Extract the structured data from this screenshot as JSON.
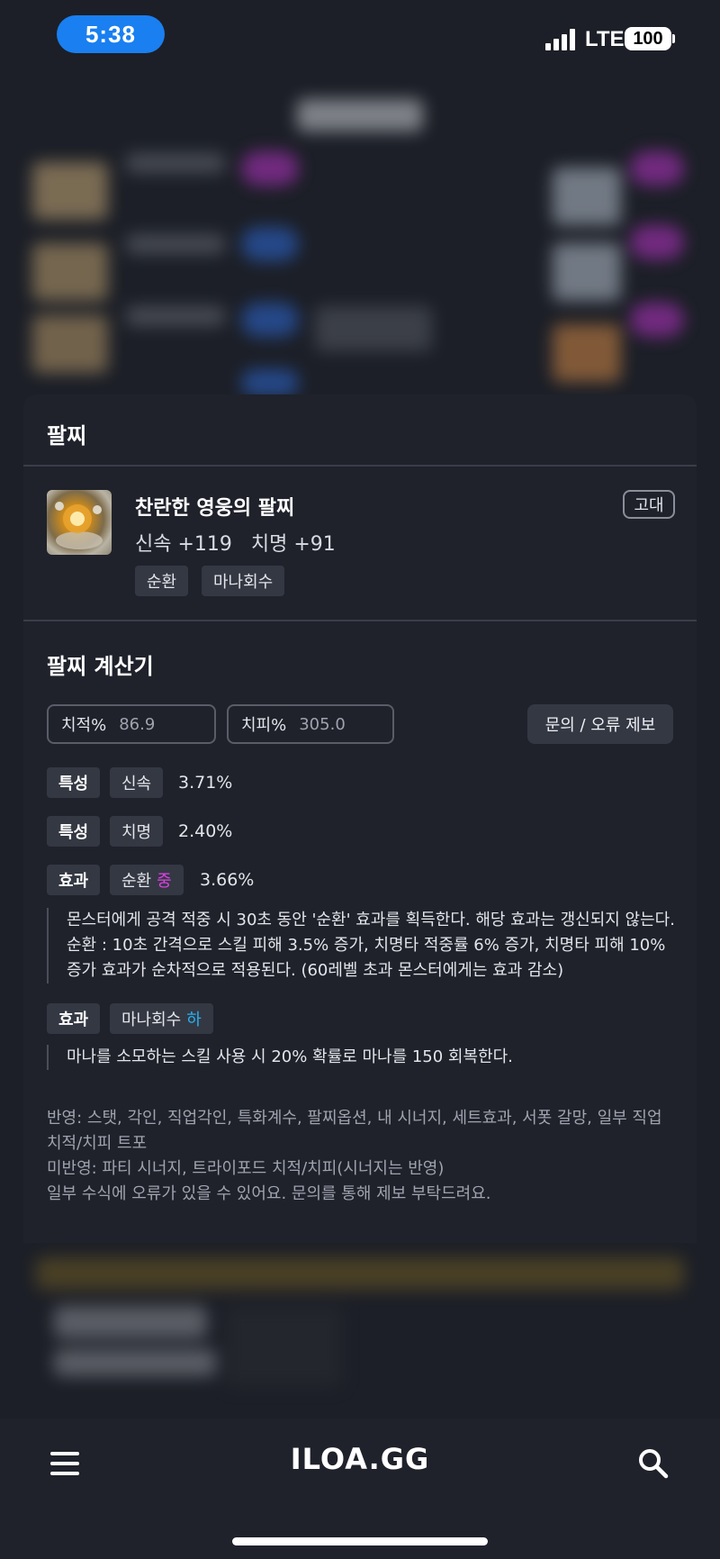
{
  "status": {
    "time": "5:38",
    "network": "LTE",
    "battery": "100"
  },
  "modal": {
    "title": "팔찌",
    "item": {
      "name": "찬란한 영웅의 팔찌",
      "stats": "신속 +119   치명 +91",
      "grade": "고대",
      "tags": [
        "순환",
        "마나회수"
      ]
    },
    "calculator": {
      "title": "팔찌 계산기",
      "crit_rate": {
        "label": "치적%",
        "placeholder": "86.9"
      },
      "crit_damage": {
        "label": "치피%",
        "placeholder": "305.0"
      },
      "report_button": "문의 / 오류 제보",
      "rows": [
        {
          "type": "특성",
          "name": "신속",
          "value": "3.71%"
        },
        {
          "type": "특성",
          "name": "치명",
          "value": "2.40%"
        },
        {
          "type": "효과",
          "name": "순환",
          "level": "중",
          "value": "3.66%"
        },
        {
          "type": "효과",
          "name": "마나회수",
          "level": "하"
        }
      ],
      "desc_cycle": "몬스터에게 공격 적중 시 30초 동안 '순환' 효과를 획득한다. 해당 효과는 갱신되지 않는다. 순환 : 10초 간격으로 스킬 피해 3.5% 증가, 치명타 적중률 6% 증가, 치명타 피해 10% 증가 효과가 순차적으로 적용된다. (60레벨 초과 몬스터에게는 효과 감소)",
      "desc_mana": "마나를 소모하는 스킬 사용 시 20% 확률로 마나를 150 회복한다.",
      "note_reflected": "반영: 스탯, 각인, 직업각인, 특화계수, 팔찌옵션, 내 시너지, 세트효과, 서폿 갈망, 일부 직업 치적/치피 트포",
      "note_unreflected": "미반영: 파티 시너지, 트라이포드 치적/치피(시너지는 반영)",
      "note_error": "일부 수식에 오류가 있을 수 있어요. 문의를 통해 제보 부탁드려요."
    }
  },
  "bottom_bar": {
    "logo": "ILOA.GG"
  },
  "colors": {
    "accent_blue": "#1a7ff0",
    "level_mid": "#e040e8",
    "level_low": "#2ab0f0"
  }
}
